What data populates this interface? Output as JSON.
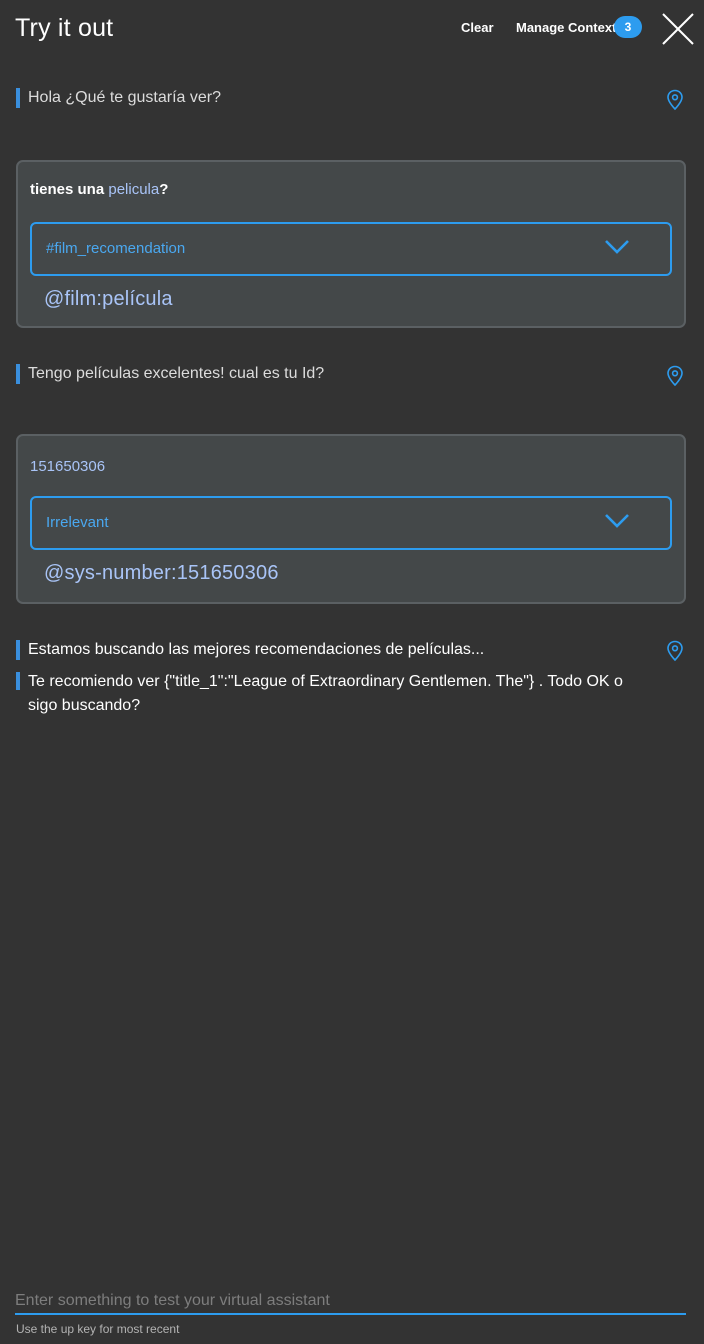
{
  "header": {
    "title": "Try it out",
    "clear_label": "Clear",
    "manage_context_label": "Manage Context",
    "context_count": "3"
  },
  "conversation": {
    "bot_1": "Hola ¿Qué te gustaría ver?",
    "user_1": {
      "text_before": "tienes una ",
      "text_highlight": "pelicula",
      "text_after": "?",
      "intent": "#film_recomendation",
      "entity": "@film:película"
    },
    "bot_2": "Tengo películas excelentes! cual es tu Id?",
    "user_2": {
      "text": "151650306",
      "intent": "Irrelevant",
      "entity": "@sys-number:151650306"
    },
    "bot_3": "Estamos buscando las mejores recomendaciones de películas...",
    "bot_4_line1": "Te recomiendo ver {\"title_1\":\"League of Extraordinary Gentlemen. The\"} . Todo OK o",
    "bot_4_line2": "sigo buscando?"
  },
  "input": {
    "placeholder": "Enter something to test your virtual assistant",
    "value": "",
    "hint": "Use the up key for most recent"
  },
  "colors": {
    "background": "#333333",
    "accent": "#2d9cef",
    "card": "#444849",
    "entity": "#a9c4f7"
  },
  "icons": [
    "close-icon",
    "location-pin-icon",
    "chevron-down-icon"
  ]
}
